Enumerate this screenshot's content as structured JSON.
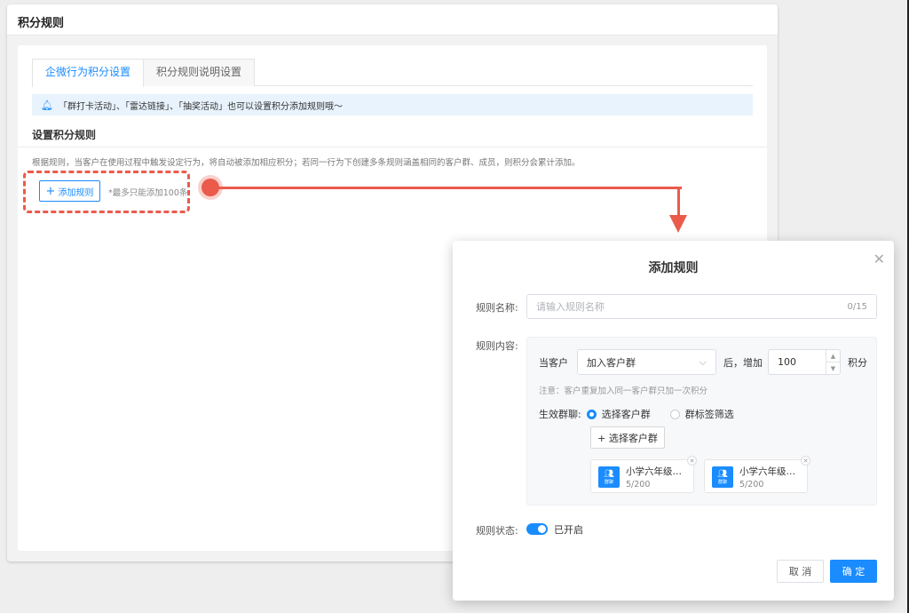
{
  "page": {
    "title": "积分规则"
  },
  "tabs": [
    {
      "label": "企微行为积分设置",
      "active": true
    },
    {
      "label": "积分规则说明设置",
      "active": false
    }
  ],
  "notice": {
    "icon": "bell-icon",
    "text": "「群打卡活动」、「雷达链接」、「抽奖活动」也可以设置积分添加规则哦～"
  },
  "section": {
    "title": "设置积分规则",
    "description": "根据规则，当客户在使用过程中触发设定行为，将自动被添加相应积分；若同一行为下创建多条规则涵盖相同的客户群、成员，则积分会累计添加。",
    "add_button": "添加规则",
    "add_icon": "plus-icon",
    "limit_text": "*最多只能添加100条"
  },
  "dialog": {
    "title": "添加规则",
    "close_icon": "close-icon",
    "name_label": "规则名称:",
    "name_placeholder": "请输入规则名称",
    "name_counter": "0/15",
    "content_label": "规则内容:",
    "when_text": "当客户",
    "action_value": "加入客户群",
    "after_text": "后，增加",
    "points_value": "100",
    "points_unit": "积分",
    "note": "注意：客户重复加入同一客户群只加一次积分",
    "effective_label": "生效群聊:",
    "radio_options": [
      {
        "label": "选择客户群",
        "selected": true
      },
      {
        "label": "群标签筛选",
        "selected": false
      }
    ],
    "select_group_button": "+ 选择客户群",
    "groups": [
      {
        "name": "小学六年级…",
        "size": "5/200",
        "icon_tag": "群聊"
      },
      {
        "name": "小学六年级…",
        "size": "5/200",
        "icon_tag": "群聊"
      }
    ],
    "status_label": "规则状态:",
    "status_on": true,
    "status_text": "已开启",
    "cancel_button": "取 消",
    "confirm_button": "确 定"
  },
  "colors": {
    "accent": "#1a8cff",
    "highlight": "#ea5b4c"
  }
}
